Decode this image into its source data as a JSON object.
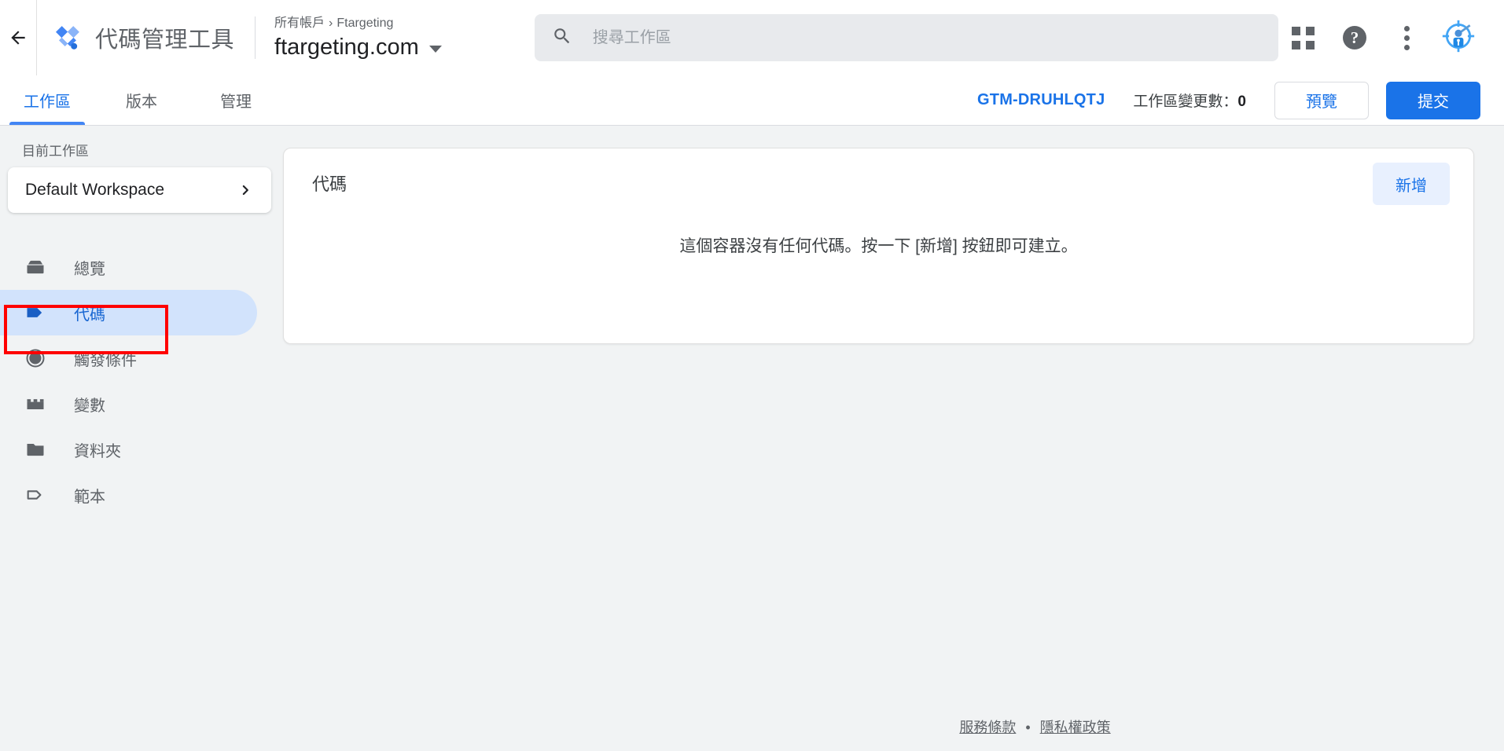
{
  "topbar": {
    "back_icon": "arrow-left-icon",
    "logo_icon": "gtm-diamond-logo",
    "product_title": "代碼管理工具",
    "breadcrumb_account": "所有帳戶",
    "breadcrumb_sep": "›",
    "breadcrumb_property": "Ftargeting",
    "container_name": "ftargeting.com",
    "search": {
      "placeholder": "搜尋工作區",
      "value": "",
      "icon": "search-icon"
    },
    "apps_icon": "apps-grid-icon",
    "help_icon": "help-question-icon",
    "help_glyph": "?",
    "more_icon": "kebab-more-icon",
    "avatar_icon": "target-person-avatar-icon"
  },
  "tabs": [
    {
      "label": "工作區",
      "active": true
    },
    {
      "label": "版本",
      "active": false
    },
    {
      "label": "管理",
      "active": false
    }
  ],
  "tabbar_right": {
    "container_id": "GTM-DRUHLQTJ",
    "changes_label": "工作區變更數：",
    "changes_count": "0",
    "preview_label": "預覽",
    "submit_label": "提交"
  },
  "sidebar": {
    "current_workspace_label": "目前工作區",
    "workspace_name": "Default Workspace",
    "workspace_chevron_icon": "chevron-right-icon",
    "items": [
      {
        "label": "總覽",
        "icon": "overview-box-icon",
        "active": false
      },
      {
        "label": "代碼",
        "icon": "tag-icon",
        "active": true
      },
      {
        "label": "觸發條件",
        "icon": "trigger-circles-icon",
        "active": false
      },
      {
        "label": "變數",
        "icon": "variables-blocks-icon",
        "active": false
      },
      {
        "label": "資料夾",
        "icon": "folder-icon",
        "active": false
      },
      {
        "label": "範本",
        "icon": "template-tag-outline-icon",
        "active": false
      }
    ]
  },
  "main": {
    "card_title": "代碼",
    "new_button_label": "新增",
    "empty_message": "這個容器沒有任何代碼。按一下 [新增] 按鈕即可建立。"
  },
  "footer": {
    "terms_label": "服務條款",
    "separator": "•",
    "privacy_label": "隱私權政策"
  },
  "annotation": {
    "color": "#ff0000",
    "target": "代碼"
  },
  "colors": {
    "accent_blue": "#1a73e8",
    "active_nav_bg": "#d2e3fc",
    "body_bg": "#f1f3f4",
    "annotation_red": "#ff0000"
  }
}
